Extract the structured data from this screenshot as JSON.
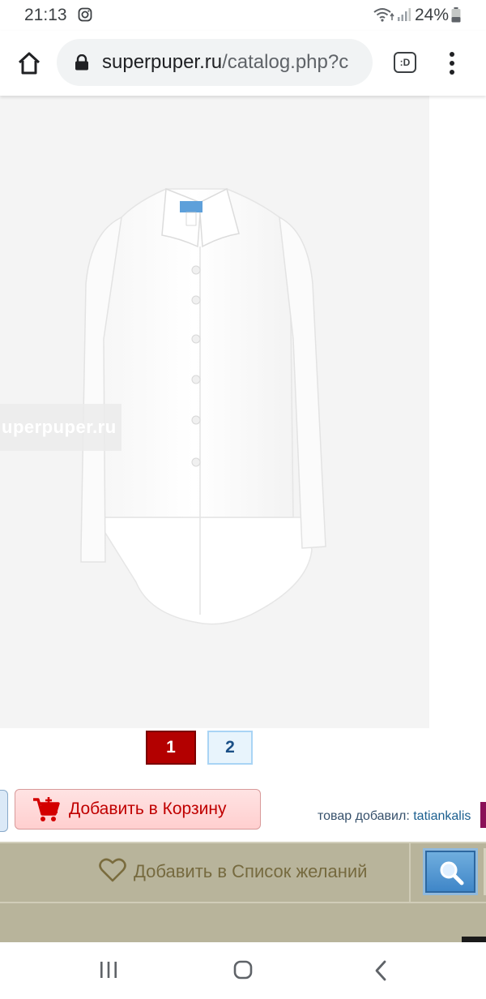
{
  "status_bar": {
    "time": "21:13",
    "battery": "24%",
    "icons": [
      "instagram-icon",
      "wifi-icon",
      "signal-icon",
      "battery-icon"
    ]
  },
  "browser": {
    "url_domain": "superpuper.ru",
    "url_path": "/catalog.php?c",
    "tabs_label": ":D"
  },
  "product": {
    "watermark": "uperpuper.ru",
    "image_alt": "white shirt",
    "pages": [
      "1",
      "2"
    ],
    "active_page": "1"
  },
  "actions": {
    "add_to_cart": "Добавить в Корзину",
    "added_by_prefix": "товар добавил:",
    "added_by_user": "tatiankalis",
    "add_to_wishlist": "Добавить в Список желаний"
  },
  "colors": {
    "accent_red": "#b30000",
    "cart_text": "#c00000",
    "wish_bar": "#b8b49b",
    "wish_text": "#766a3f",
    "zoom_blue": "#3f86c8"
  }
}
